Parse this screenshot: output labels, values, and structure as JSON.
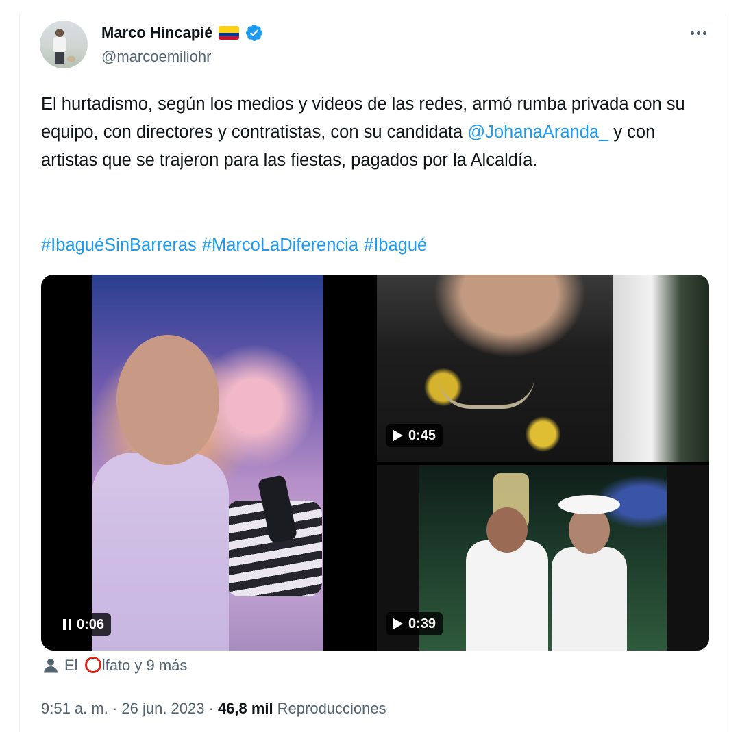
{
  "author": {
    "name": "Marco Hincapié",
    "handle": "@marcoemiliohr",
    "flag_icon": "colombia-flag-icon",
    "verified_icon": "verified-badge-icon",
    "verified_color": "#1d9bf0"
  },
  "tweet": {
    "text_part1": "El hurtadismo, según los medios y videos de las redes, armó rumba privada con su equipo, con directores y contratistas, con su candidata ",
    "mention": "@JohanaAranda_",
    "text_part2": " y con artistas que se trajeron para las fiestas, pagados por la Alcaldía.",
    "hashtags": [
      "#IbaguéSinBarreras",
      "#MarcoLaDiferencia",
      "#Ibagué"
    ]
  },
  "media": [
    {
      "duration": "0:06",
      "state": "paused-icon"
    },
    {
      "duration": "0:45",
      "state": "play-icon"
    },
    {
      "duration": "0:39",
      "state": "play-icon"
    }
  ],
  "social_context": {
    "prefix": "El ",
    "suffix": "lfato y 9 más",
    "logo_color": "#e0261f"
  },
  "meta": {
    "time_date": "9:51 a. m. · 26 jun. 2023 ·",
    "views_count": "46,8 mil",
    "views_label": "Reproducciones"
  },
  "colors": {
    "link": "#1d9bf0",
    "text": "#0f1419",
    "secondary": "#536471"
  }
}
